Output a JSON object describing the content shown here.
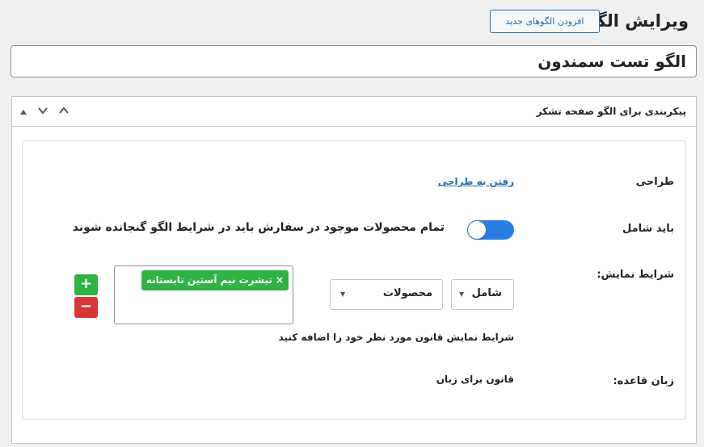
{
  "header": {
    "title": "ویرایش الگو",
    "add_new_label": "افزودن الگوهای جدید"
  },
  "title_field": {
    "value": "الگو تست سمندون"
  },
  "metabox": {
    "title": "پیکربندی برای الگو صفحه تشکر",
    "rows": {
      "design": {
        "label": "طراحی",
        "link_text": "رفتن به طراحی"
      },
      "must_include": {
        "label": "باید شامل",
        "toggle_on": true,
        "toggle_text": "تمام محصولات موجود در سفارش باید در شرایط الگو گنجانده شوند"
      },
      "display_conditions": {
        "label": "شرایط نمایش:",
        "condition_select": "شامل",
        "type_select": "محصولات",
        "selected_tags": [
          "تیشرت نیم آستین تابستانه"
        ],
        "tag_remove_symbol": "×",
        "helper_text": "شرایط نمایش قانون مورد نظر خود را اضافه کنید",
        "add_symbol": "+",
        "remove_symbol": "−"
      },
      "base_language": {
        "label": "زبان قاعده:",
        "value": "قانون برای زبان"
      }
    }
  },
  "colors": {
    "accent": "#2271b1",
    "toggle": "#2a7de1",
    "add": "#2fb344",
    "remove": "#d63638"
  }
}
